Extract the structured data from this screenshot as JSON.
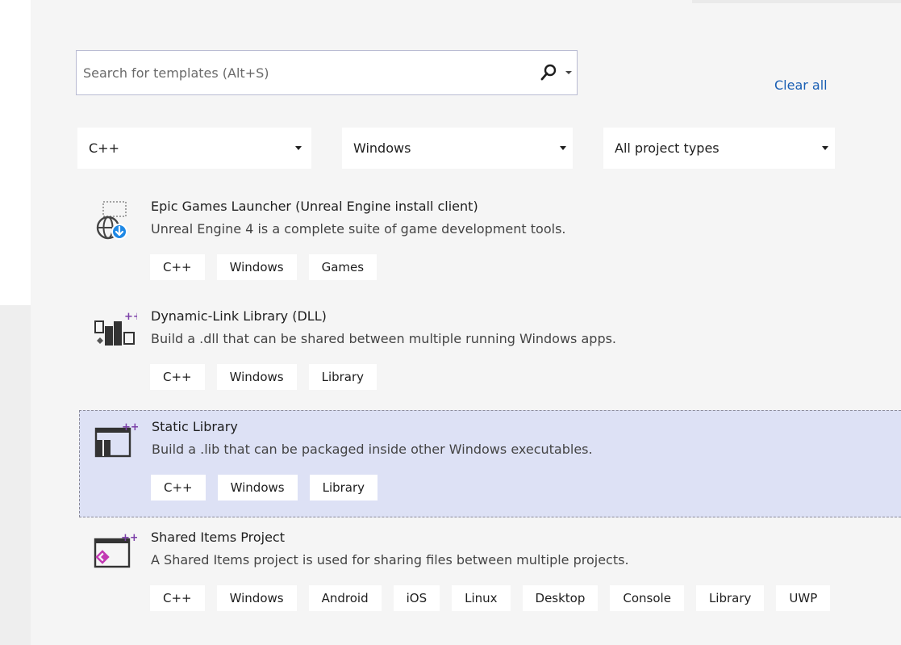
{
  "search": {
    "placeholder": "Search for templates (Alt+S)",
    "value": ""
  },
  "clear_all_label": "Clear all",
  "filters": {
    "language": "C++",
    "platform": "Windows",
    "project_type": "All project types"
  },
  "templates": [
    {
      "title": "Epic Games Launcher (Unreal Engine install client)",
      "description": "Unreal Engine 4 is a complete suite of game development tools.",
      "icon": "globe-download-icon",
      "tags": [
        "C++",
        "Windows",
        "Games"
      ],
      "selected": false
    },
    {
      "title": "Dynamic-Link Library (DLL)",
      "description": "Build a .dll that can be shared between multiple running Windows apps.",
      "icon": "dll-library-icon",
      "tags": [
        "C++",
        "Windows",
        "Library"
      ],
      "selected": false
    },
    {
      "title": "Static Library",
      "description": "Build a .lib that can be packaged inside other Windows executables.",
      "icon": "static-library-icon",
      "tags": [
        "C++",
        "Windows",
        "Library"
      ],
      "selected": true
    },
    {
      "title": "Shared Items Project",
      "description": "A Shared Items project is used for sharing files between multiple projects.",
      "icon": "shared-items-icon",
      "tags": [
        "C++",
        "Windows",
        "Android",
        "iOS",
        "Linux",
        "Desktop",
        "Console",
        "Library",
        "UWP"
      ],
      "selected": false
    }
  ],
  "colors": {
    "accent_link": "#1a5fb4",
    "selected_row": "#dde1f5",
    "badge_blue": "#1e88e5"
  }
}
